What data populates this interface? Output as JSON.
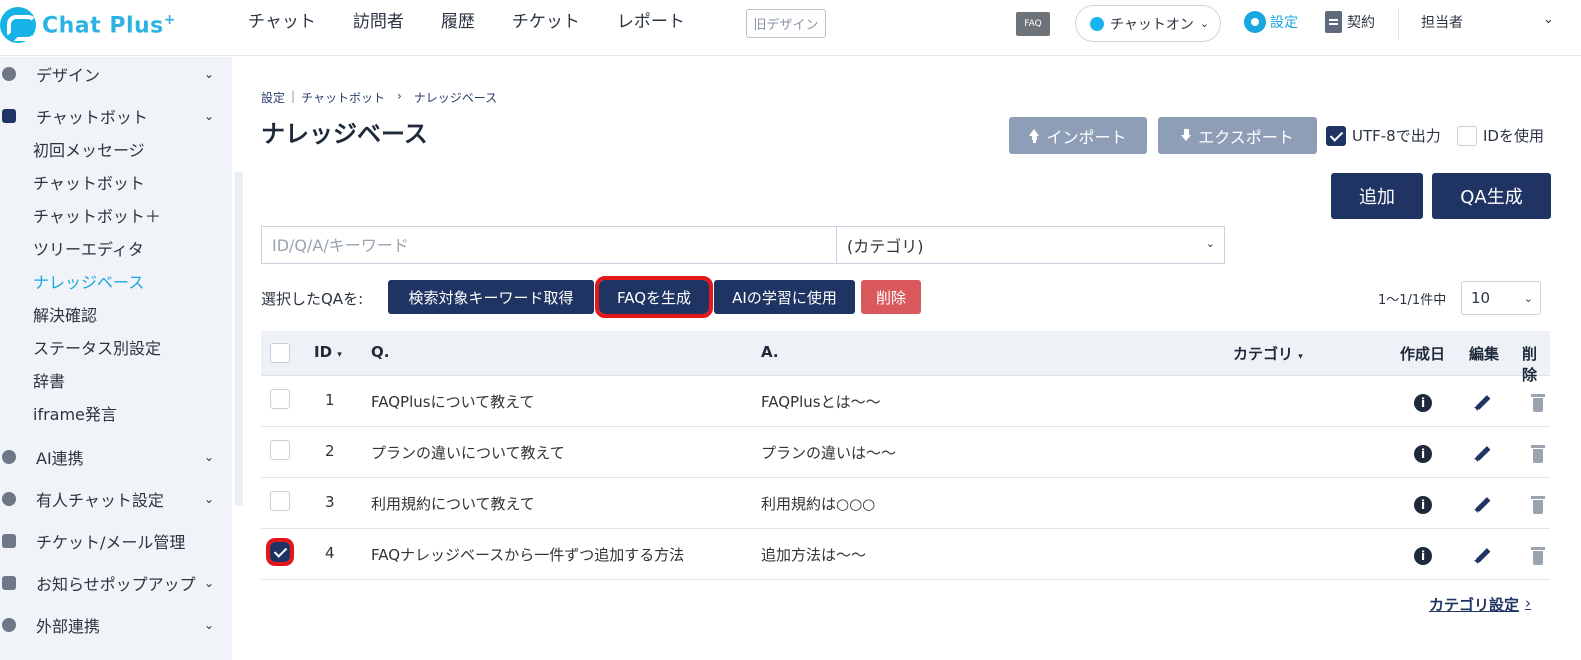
{
  "header": {
    "logo_text": "Chat Plus",
    "logo_sup": "+",
    "nav": [
      "チャット",
      "訪問者",
      "履歴",
      "チケット",
      "レポート"
    ],
    "old_design": "旧デザイン",
    "faq_icon_label": "FAQ",
    "status": "チャットオン",
    "settings": "設定",
    "contract": "契約",
    "person": "担当者",
    "accent": "#1aa7e0"
  },
  "sidebar": {
    "sections": [
      {
        "label": "デザイン",
        "icon": "palette-icon"
      },
      {
        "label": "チャットボット",
        "icon": "chat-icon"
      },
      {
        "label": "AI連携",
        "icon": "ai-icon"
      },
      {
        "label": "有人チャット設定",
        "icon": "headset-icon"
      },
      {
        "label": "チケット/メール管理",
        "icon": "ticket-icon"
      },
      {
        "label": "お知らせポップアップ",
        "icon": "popup-icon"
      },
      {
        "label": "外部連携",
        "icon": "share-icon"
      }
    ],
    "chatbot_items": [
      "初回メッセージ",
      "チャットボット",
      "チャットボット＋",
      "ツリーエディタ",
      "ナレッジベース",
      "解決確認",
      "ステータス別設定",
      "辞書",
      "iframe発言"
    ],
    "active_item": "ナレッジベース"
  },
  "breadcrumb": [
    "設定",
    "チャットボット",
    "ナレッジベース"
  ],
  "breadcrumb_sep": "|",
  "breadcrumb_arrow": "›",
  "page_title": "ナレッジベース",
  "toolbar": {
    "import": "インポート",
    "export": "エクスポート",
    "utf8": "UTF-8で出力",
    "utf8_checked": true,
    "use_id": "IDを使用",
    "use_id_checked": false,
    "add": "追加",
    "qa_gen": "QA生成"
  },
  "search": {
    "placeholder": "ID/Q/A/キーワード",
    "value": "",
    "category_selected": "(カテゴリ)"
  },
  "bulk": {
    "label": "選択したQAを:",
    "keyword": "検索対象キーワード取得",
    "faq": "FAQを生成",
    "ai": "AIの学習に使用",
    "delete": "削除"
  },
  "pager": {
    "text": "1～1/1件中",
    "per_page": "10"
  },
  "table": {
    "headers": {
      "id": "ID",
      "q": "Q.",
      "a": "A.",
      "category": "カテゴリ",
      "created": "作成日",
      "edit": "編集",
      "delete": "削除"
    },
    "rows": [
      {
        "id": "1",
        "q": "FAQPlusについて教えて",
        "a": "FAQPlusとは～～",
        "category": "",
        "checked": false
      },
      {
        "id": "2",
        "q": "プランの違いについて教えて",
        "a": "プランの違いは～～",
        "category": "",
        "checked": false
      },
      {
        "id": "3",
        "q": "利用規約について教えて",
        "a": "利用規約は○○○",
        "category": "",
        "checked": false
      },
      {
        "id": "4",
        "q": "FAQナレッジベースから一件ずつ追加する方法",
        "a": "追加方法は～～",
        "category": "",
        "checked": true
      }
    ]
  },
  "category_settings": "カテゴリ設定",
  "colors": {
    "navy": "#1f3462",
    "gray_button": "#8f9eb7",
    "red_button": "#d9595c",
    "highlight": "#e4171b"
  }
}
